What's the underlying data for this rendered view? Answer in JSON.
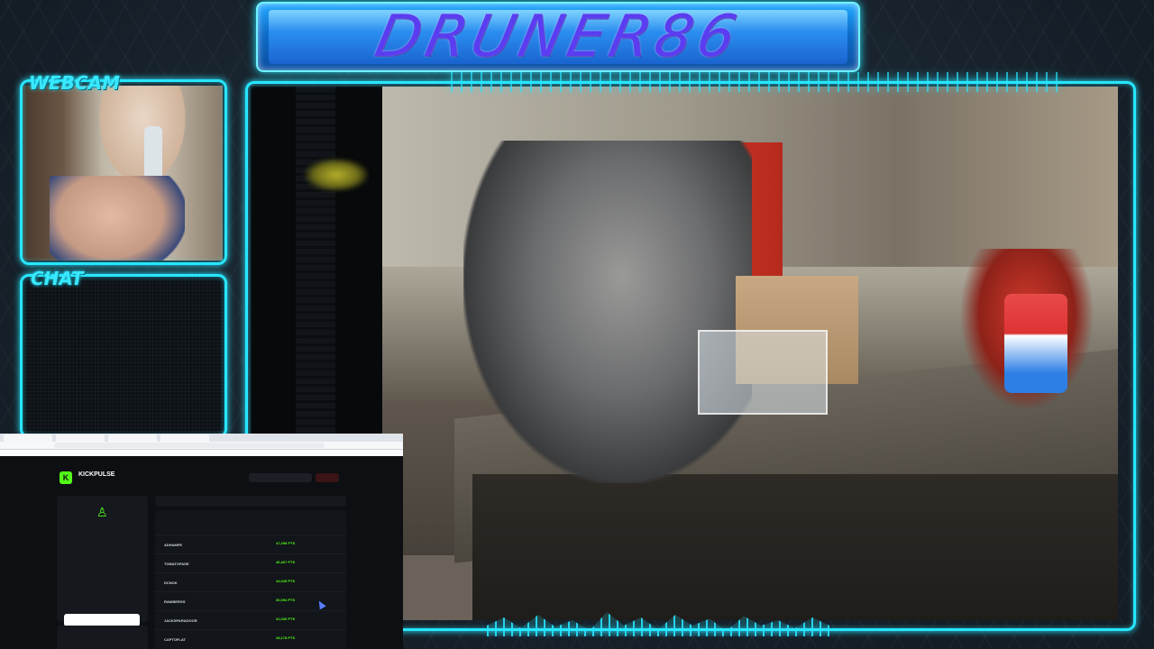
{
  "overlay": {
    "title": "DRUNER86",
    "webcam_label": "WEBCAM",
    "chat_label": "CHAT"
  },
  "colors": {
    "accent": "#27e6ff",
    "kick_green": "#53fc18"
  },
  "kickpulse": {
    "logo_letter": "K",
    "app_name": "KICKPULSE"
  },
  "leaderboard": {
    "rows": [
      {
        "name": "ADHAMFE",
        "points": "47,298 PTS"
      },
      {
        "name": "TOMATOPASE",
        "points": "46,467 PTS"
      },
      {
        "name": "DCNOK",
        "points": "44,045 PTS"
      },
      {
        "name": "RAWBERGS",
        "points": "30,054 PTS"
      },
      {
        "name": "JACKSPARADOOR",
        "points": "31,030 PTS"
      },
      {
        "name": "CAPTOFLAT",
        "points": "28,178 PTS"
      }
    ]
  }
}
